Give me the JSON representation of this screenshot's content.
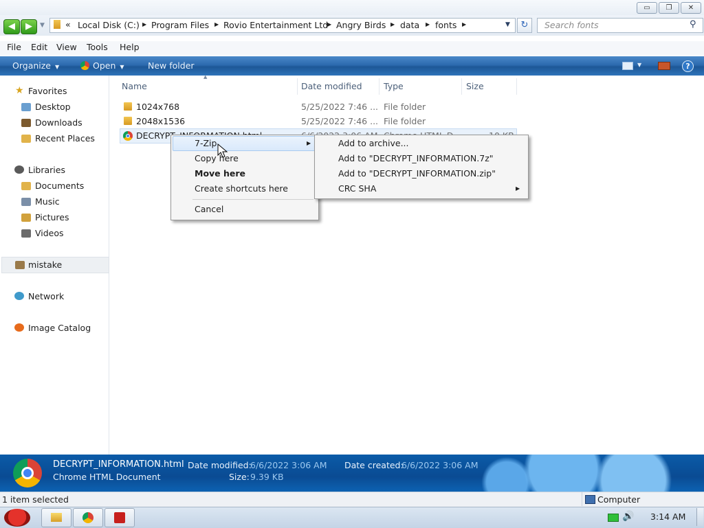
{
  "window": {
    "min_glyph": "▭",
    "max_glyph": "❐",
    "close_glyph": "✕"
  },
  "address": {
    "overflow": "«",
    "crumbs": [
      "Local Disk (C:)",
      "Program Files",
      "Rovio Entertainment Ltd",
      "Angry Birds",
      "data",
      "fonts"
    ],
    "search_placeholder": "Search fonts"
  },
  "menu": [
    "File",
    "Edit",
    "View",
    "Tools",
    "Help"
  ],
  "commands": {
    "organize": "Organize",
    "open": "Open",
    "new_folder": "New folder"
  },
  "nav": {
    "favorites": "Favorites",
    "favorites_items": [
      "Desktop",
      "Downloads",
      "Recent Places"
    ],
    "libraries": "Libraries",
    "libraries_items": [
      "Documents",
      "Music",
      "Pictures",
      "Videos"
    ],
    "mistake": "mistake",
    "network": "Network",
    "image_catalog": "Image Catalog"
  },
  "columns": {
    "name": "Name",
    "date": "Date modified",
    "type": "Type",
    "size": "Size"
  },
  "files": [
    {
      "name": "1024x768",
      "date": "5/25/2022 7:46 ...",
      "type": "File folder"
    },
    {
      "name": "2048x1536",
      "date": "5/25/2022 7:46 ...",
      "type": "File folder"
    },
    {
      "name": "DECRYPT_INFORMATION.html",
      "date": "6/6/2022 3:06 AM",
      "type": "Chrome HTML D...",
      "size": "10 KB"
    }
  ],
  "context_menu": {
    "items": [
      "7-Zip",
      "Copy here",
      "Move here",
      "Create shortcuts here",
      "Cancel"
    ]
  },
  "submenu": {
    "items": [
      "Add to archive...",
      "Add to \"DECRYPT_INFORMATION.7z\"",
      "Add to \"DECRYPT_INFORMATION.zip\"",
      "CRC SHA"
    ]
  },
  "details": {
    "filename": "DECRYPT_INFORMATION.html",
    "type": "Chrome HTML Document",
    "date_modified_label": "Date modified:",
    "date_modified": "6/6/2022 3:06 AM",
    "date_created_label": "Date created:",
    "date_created": "6/6/2022 3:06 AM",
    "size_label": "Size:",
    "size": "9.39 KB"
  },
  "status": {
    "selection": "1 item selected",
    "location": "Computer"
  },
  "taskbar": {
    "clock": "3:14 AM"
  }
}
